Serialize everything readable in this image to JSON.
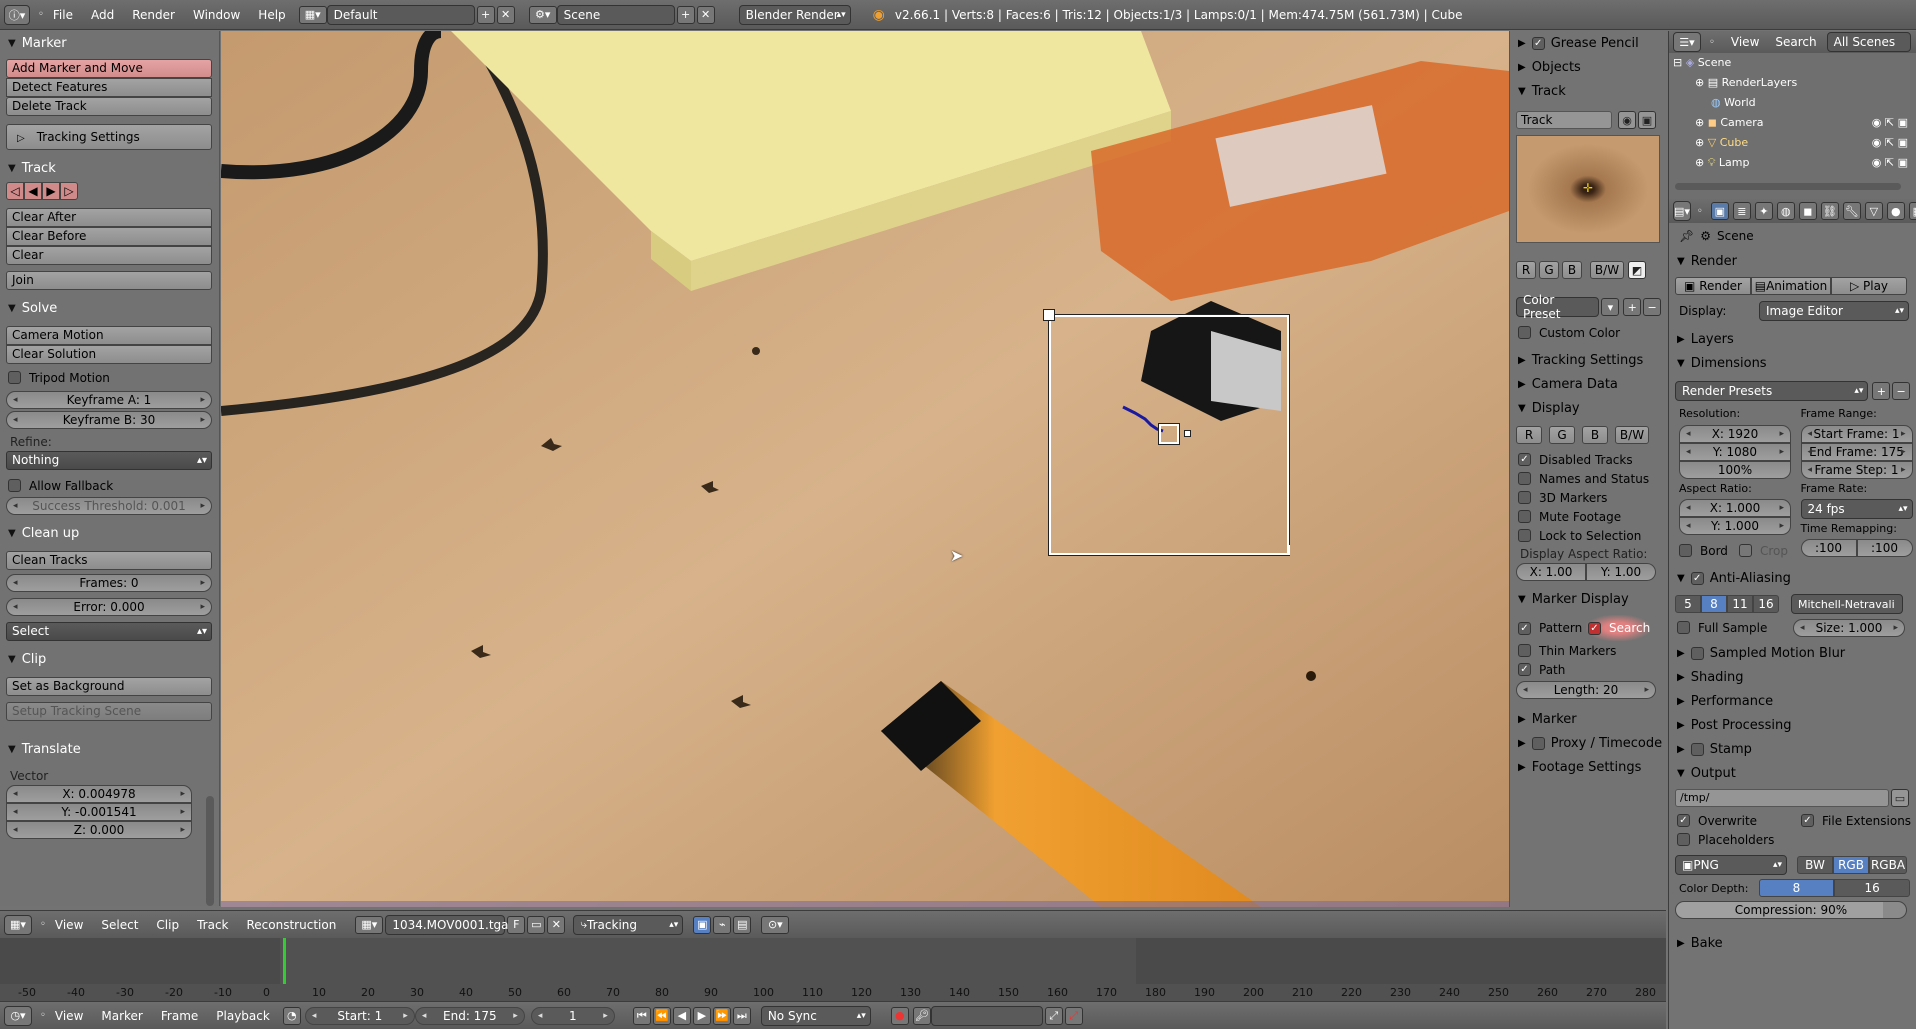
{
  "topbar": {
    "menus": [
      "File",
      "Add",
      "Render",
      "Window",
      "Help"
    ],
    "layout": "Default",
    "scene": "Scene",
    "engine": "Blender Render",
    "status": "v2.66.1 | Verts:8 | Faces:6 | Tris:12 | Objects:1/3 | Lamps:0/1 | Mem:474.75M (561.73M) | Cube"
  },
  "toolshelf": {
    "marker": {
      "title": "Marker",
      "add": "Add Marker and Move",
      "detect": "Detect Features",
      "delete": "Delete Track",
      "tracking_settings": "Tracking Settings"
    },
    "track": {
      "title": "Track",
      "clear_after": "Clear After",
      "clear_before": "Clear Before",
      "clear": "Clear",
      "join": "Join"
    },
    "solve": {
      "title": "Solve",
      "camera_motion": "Camera Motion",
      "clear_solution": "Clear Solution",
      "tripod": "Tripod Motion",
      "keyframe_a": "Keyframe A: 1",
      "keyframe_b": "Keyframe B: 30",
      "refine_label": "Refine:",
      "refine_value": "Nothing",
      "fallback": "Allow Fallback",
      "threshold": "Success Threshold: 0.001"
    },
    "cleanup": {
      "title": "Clean up",
      "clean_tracks": "Clean Tracks",
      "frames": "Frames: 0",
      "error": "Error: 0.000",
      "select": "Select"
    },
    "clip": {
      "title": "Clip",
      "set_bg": "Set as Background",
      "setup_scene": "Setup Tracking Scene"
    },
    "translate": {
      "title": "Translate",
      "vector": "Vector",
      "x": "X: 0.004978",
      "y": "Y: -0.001541",
      "z": "Z: 0.000"
    }
  },
  "side": {
    "grease": "Grease Pencil",
    "objects": "Objects",
    "track_title": "Track",
    "track_name": "Track",
    "r": "R",
    "g": "G",
    "b": "B",
    "bw": "B/W",
    "color_preset": "Color Preset",
    "custom_color": "Custom Color",
    "tracking_settings": "Tracking Settings",
    "camera_data": "Camera Data",
    "display": "Display",
    "disabled_tracks": "Disabled Tracks",
    "names_status": "Names and Status",
    "markers_3d": "3D Markers",
    "mute": "Mute Footage",
    "lock": "Lock to Selection",
    "aspect_label": "Display Aspect Ratio:",
    "ax": "X: 1.00",
    "ay": "Y: 1.00",
    "marker_display": "Marker Display",
    "pattern": "Pattern",
    "search": "Search",
    "thin": "Thin Markers",
    "path": "Path",
    "length": "Length: 20",
    "marker": "Marker",
    "proxy": "Proxy / Timecode",
    "footage": "Footage Settings"
  },
  "outliner": {
    "view": "View",
    "search": "Search",
    "scenes": "All Scenes",
    "items": [
      "Scene",
      "RenderLayers",
      "World",
      "Camera",
      "Cube",
      "Lamp"
    ]
  },
  "props": {
    "scene": "Scene",
    "render_title": "Render",
    "render": "Render",
    "animation": "Animation",
    "play": "Play",
    "display_label": "Display:",
    "display_value": "Image Editor",
    "layers": "Layers",
    "dimensions": "Dimensions",
    "presets": "Render Presets",
    "resolution": "Resolution:",
    "res_x": "X: 1920",
    "res_y": "Y: 1080",
    "res_pct": "100%",
    "frame_range": "Frame Range:",
    "start": "Start Frame: 1",
    "end": "End Frame: 175",
    "step": "Frame Step: 1",
    "aspect": "Aspect Ratio:",
    "asp_x": "X: 1.000",
    "asp_y": "Y: 1.000",
    "frame_rate": "Frame Rate:",
    "fps": "24 fps",
    "time_remap": "Time Remapping:",
    "old": ":100",
    "new": ":100",
    "bord": "Bord",
    "crop": "Crop",
    "aa": "Anti-Aliasing",
    "aa_vals": [
      "5",
      "8",
      "11",
      "16"
    ],
    "filter": "Mitchell-Netravali",
    "full_sample": "Full Sample",
    "size": "Size: 1.000",
    "smb": "Sampled Motion Blur",
    "shading": "Shading",
    "performance": "Performance",
    "post": "Post Processing",
    "stamp": "Stamp",
    "output": "Output",
    "path": "/tmp/",
    "overwrite": "Overwrite",
    "file_ext": "File Extensions",
    "placeholders": "Placeholders",
    "format": "PNG",
    "bw": "BW",
    "rgb": "RGB",
    "rgba": "RGBA",
    "depth_label": "Color Depth:",
    "d8": "8",
    "d16": "16",
    "compression": "Compression: 90%",
    "bake": "Bake"
  },
  "clipbar": {
    "menus": [
      "View",
      "Select",
      "Clip",
      "Track",
      "Reconstruction"
    ],
    "clip_name": "1034.MOV0001.tga",
    "f": "F",
    "mode": "Tracking"
  },
  "timeline": {
    "ticks": [
      "-50",
      "-40",
      "-30",
      "-20",
      "-10",
      "0",
      "10",
      "20",
      "30",
      "40",
      "50",
      "60",
      "70",
      "80",
      "90",
      "100",
      "110",
      "120",
      "130",
      "140",
      "150",
      "160",
      "170",
      "180",
      "190",
      "200",
      "210",
      "220",
      "230",
      "240",
      "250",
      "260",
      "270",
      "280"
    ]
  },
  "tlbar": {
    "menus": [
      "View",
      "Marker",
      "Frame",
      "Playback"
    ],
    "start": "Start: 1",
    "end": "End: 175",
    "current": "1",
    "sync": "No Sync"
  }
}
